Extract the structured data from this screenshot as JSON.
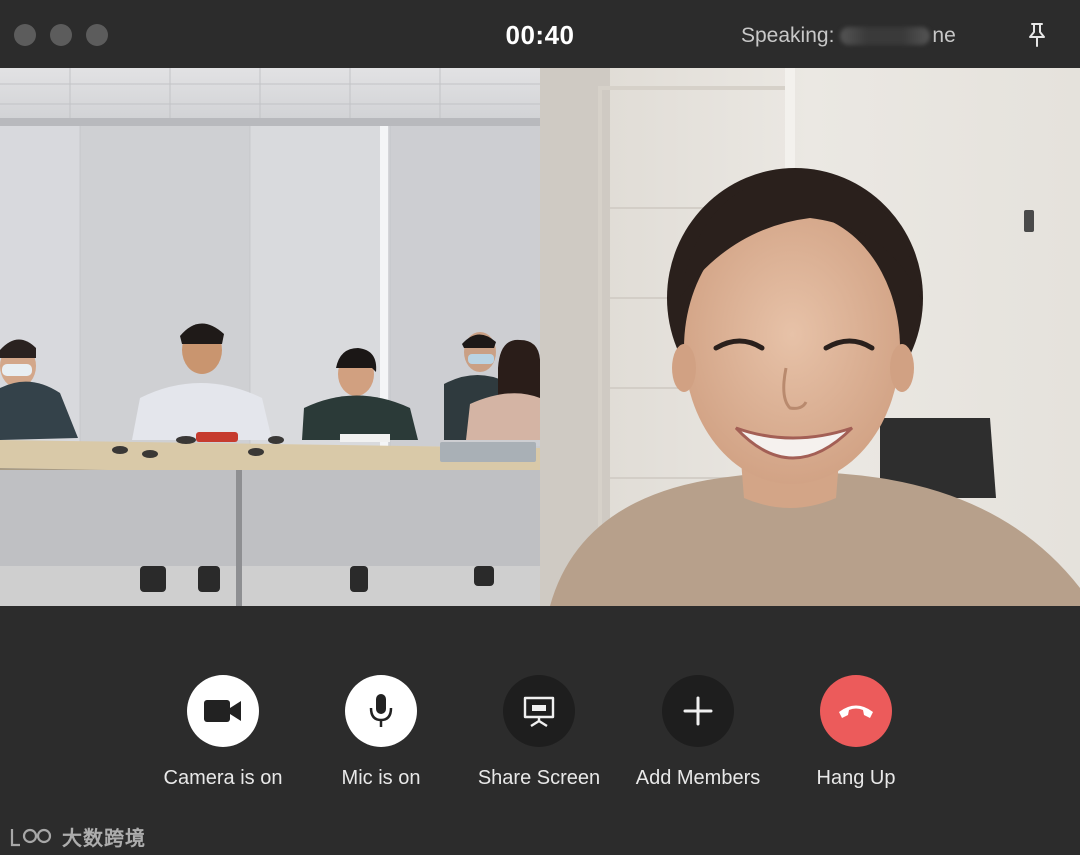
{
  "window": {
    "timer": "00:40",
    "speaking_prefix": "Speaking: ",
    "speaking_name_start": "",
    "speaking_name_end": "ne",
    "pin_icon": "pin-icon"
  },
  "videos": {
    "left": {
      "description_icon": "video-feed-conference-room"
    },
    "right": {
      "description_icon": "video-feed-participant"
    }
  },
  "controls": [
    {
      "label": "Camera is on",
      "icon": "video-camera-icon",
      "state": "on"
    },
    {
      "label": "Mic is on",
      "icon": "microphone-icon",
      "state": "on"
    },
    {
      "label": "Share Screen",
      "icon": "share-screen-icon",
      "state": "off"
    },
    {
      "label": "Add Members",
      "icon": "plus-icon",
      "state": "off"
    },
    {
      "label": "Hang Up",
      "icon": "phone-hangup-icon",
      "state": "danger"
    }
  ],
  "watermark": {
    "text": "大数跨境",
    "logo_text": "LCO"
  },
  "colors": {
    "background": "#2c2c2c",
    "active_button": "#ffffff",
    "inactive_button": "#1e1e1e",
    "hangup": "#ec5b5b"
  }
}
